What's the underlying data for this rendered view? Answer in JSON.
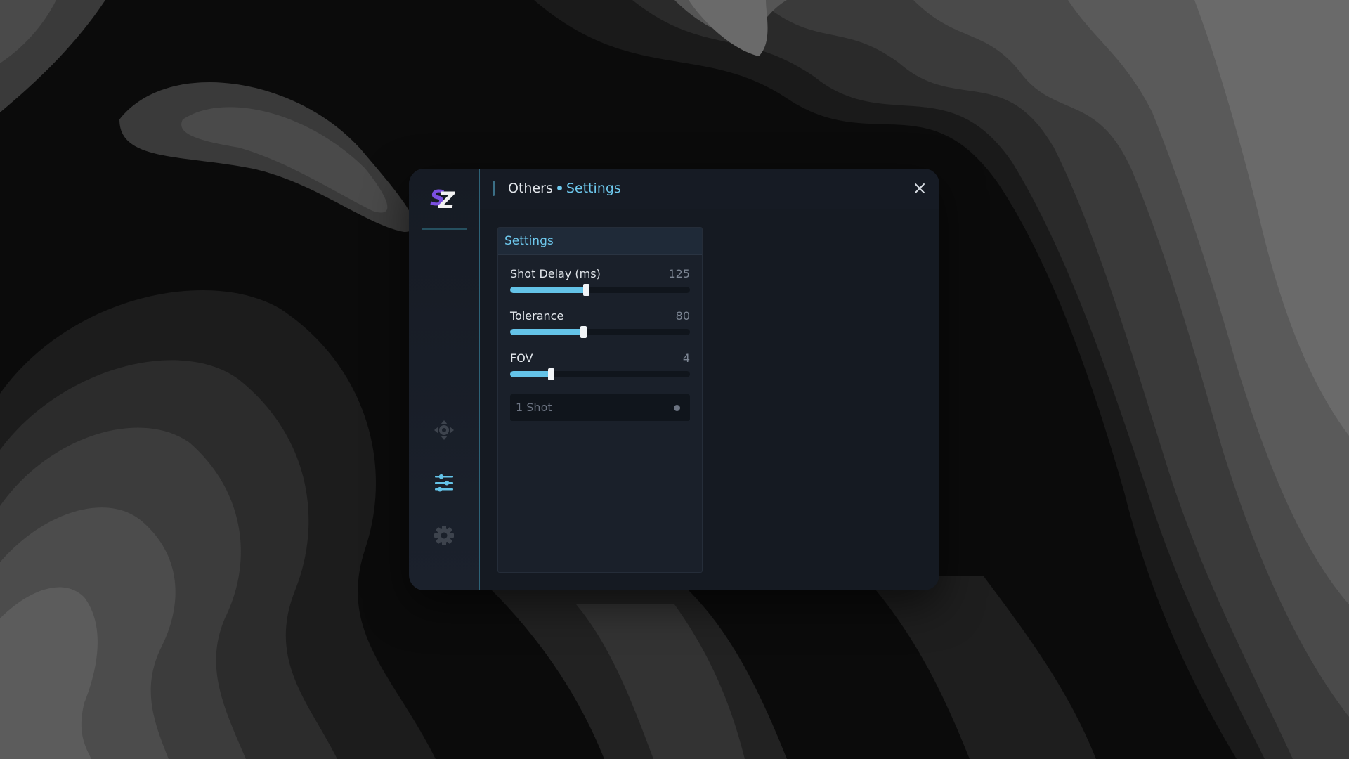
{
  "colors": {
    "accent": "#6ec9ee",
    "slider_fill": "#64c3e8",
    "window_bg": "#151a22",
    "panel_bg": "#1a202a",
    "text_primary": "#e3e7ec",
    "text_muted": "#7c8593",
    "logo_purple": "#7b4fe0"
  },
  "app": {
    "logo": {
      "text": "SZ",
      "icon": "sz-logo-icon"
    }
  },
  "sidebar": {
    "items": [
      {
        "id": "aim",
        "icon": "crosshair-icon",
        "active": false
      },
      {
        "id": "others",
        "icon": "sliders-icon",
        "active": true
      },
      {
        "id": "settings",
        "icon": "gear-icon",
        "active": false
      }
    ]
  },
  "header": {
    "parent": "Others",
    "current": "Settings",
    "close_icon": "close-icon"
  },
  "panel": {
    "title": "Settings",
    "sliders": [
      {
        "label": "Shot Delay (ms)",
        "value": "125",
        "fraction": 0.42
      },
      {
        "label": "Tolerance",
        "value": "80",
        "fraction": 0.405
      },
      {
        "label": "FOV",
        "value": "4",
        "fraction": 0.225
      }
    ],
    "select": {
      "value": "1 Shot"
    }
  }
}
